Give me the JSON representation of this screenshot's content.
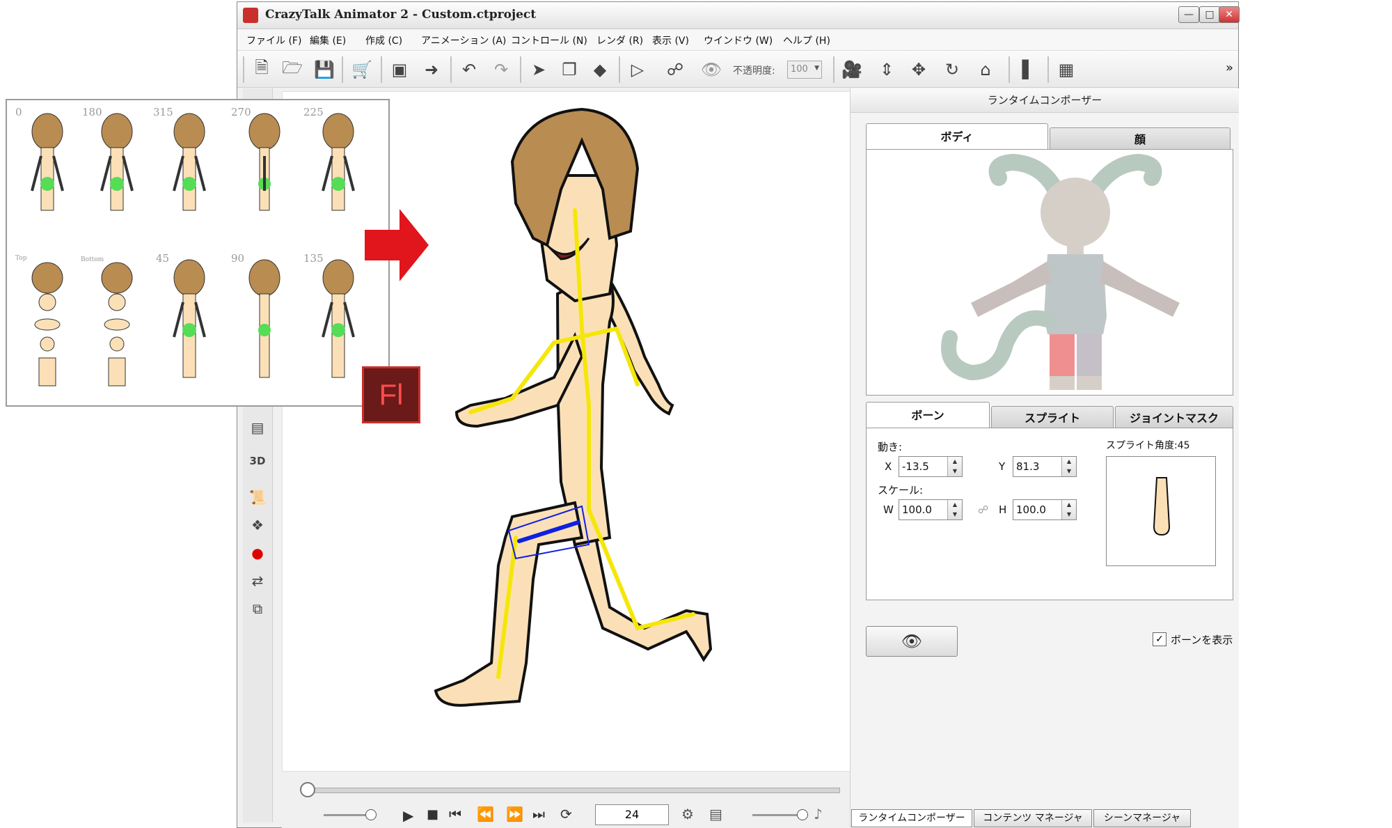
{
  "window": {
    "title": "CrazyTalk Animator 2   - Custom.ctproject"
  },
  "menu": [
    "ファイル (F)",
    "編集 (E)",
    "作成 (C)",
    "アニメーション (A)",
    "コントロール (N)",
    "レンダ (R)",
    "表示 (V)",
    "ウインドウ (W)",
    "ヘルプ (H)"
  ],
  "toolbar": {
    "opacity_label": "不透明度:",
    "opacity_value": "100",
    "more": "»"
  },
  "left_bar": {
    "btn_3d": "3D"
  },
  "panel": {
    "title": "ランタイムコンポーザー",
    "tabs_top": [
      "ボディ",
      "顔"
    ],
    "tabs_mid": [
      "ボーン",
      "スプライト",
      "ジョイントマスク"
    ],
    "move_label": "動き:",
    "x_label": "X",
    "x_value": "-13.5",
    "y_label": "Y",
    "y_value": "81.3",
    "scale_label": "スケール:",
    "w_label": "W",
    "w_value": "100.0",
    "h_label": "H",
    "h_value": "100.0",
    "sprite_angle": "スプライト角度:45",
    "show_bones_label": "ボーンを表示",
    "show_bones_checked": true
  },
  "bottom_tabs": [
    "ランタイムコンポーザー",
    "コンテンツ マネージャ",
    "シーンマネージャ"
  ],
  "timeline": {
    "frame": "24"
  },
  "reference_sheet": {
    "row1_angles": [
      "0",
      "180",
      "315",
      "270",
      "225"
    ],
    "row2_labels": [
      "Top",
      "Bottom"
    ],
    "row2_angles": [
      "45",
      "90",
      "135"
    ],
    "app_icon_text": "Fl"
  },
  "colors": {
    "arrow": "#e0161c",
    "bone": "#f5e60a",
    "selected_bone": "#1020e0",
    "skin": "#fbe0b7",
    "hair": "#b98c52",
    "highlight_limb": "#f08f8f"
  }
}
